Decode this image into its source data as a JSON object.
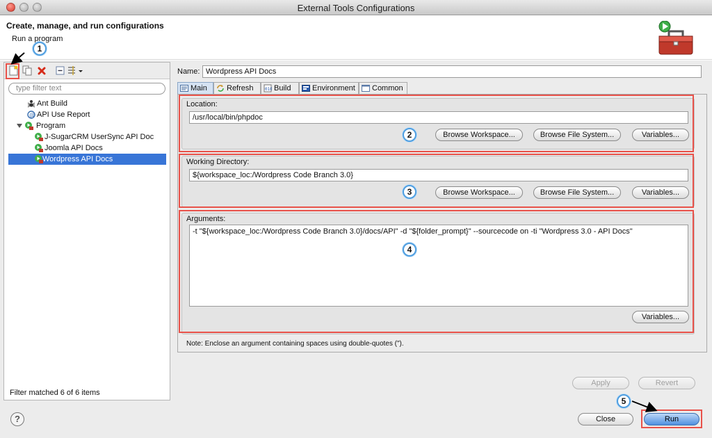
{
  "window": {
    "title": "External Tools Configurations"
  },
  "header": {
    "title": "Create, manage, and run configurations",
    "subtitle": "Run a program"
  },
  "left": {
    "filter_placeholder": "type filter text",
    "tree": [
      {
        "label": "Ant Build",
        "icon": "ant-build-icon"
      },
      {
        "label": "API Use Report",
        "icon": "api-report-icon"
      },
      {
        "label": "Program",
        "icon": "program-icon"
      },
      {
        "label": "J-SugarCRM UserSync API Doc",
        "icon": "program-config-icon"
      },
      {
        "label": "Joomla API Docs",
        "icon": "program-config-icon"
      },
      {
        "label": "Wordpress API Docs",
        "icon": "program-config-icon"
      }
    ],
    "status": "Filter matched 6 of 6 items"
  },
  "config": {
    "name_label": "Name:",
    "name_value": "Wordpress API Docs",
    "tabs": [
      "Main",
      "Refresh",
      "Build",
      "Environment",
      "Common"
    ],
    "location": {
      "label": "Location:",
      "value": "/usr/local/bin/phpdoc"
    },
    "working_directory": {
      "label": "Working Directory:",
      "value": "${workspace_loc:/Wordpress Code Branch 3.0}"
    },
    "arguments": {
      "label": "Arguments:",
      "value": "-t \"${workspace_loc:/Wordpress Code Branch 3.0}/docs/API\" -d \"${folder_prompt}\"  --sourcecode on -ti \"Wordpress 3.0 - API Docs\""
    },
    "buttons": {
      "browse_workspace": "Browse Workspace...",
      "browse_file_system": "Browse File System...",
      "variables": "Variables..."
    },
    "note": "Note: Enclose an argument containing spaces using double-quotes (\")."
  },
  "actions": {
    "apply": "Apply",
    "revert": "Revert",
    "close": "Close",
    "run": "Run"
  },
  "help": "?",
  "callouts": [
    "1",
    "2",
    "3",
    "4",
    "5"
  ],
  "colors": {
    "highlight": "#e8524a",
    "selection": "#3875d7",
    "callout_ring": "#4f9ee0"
  }
}
